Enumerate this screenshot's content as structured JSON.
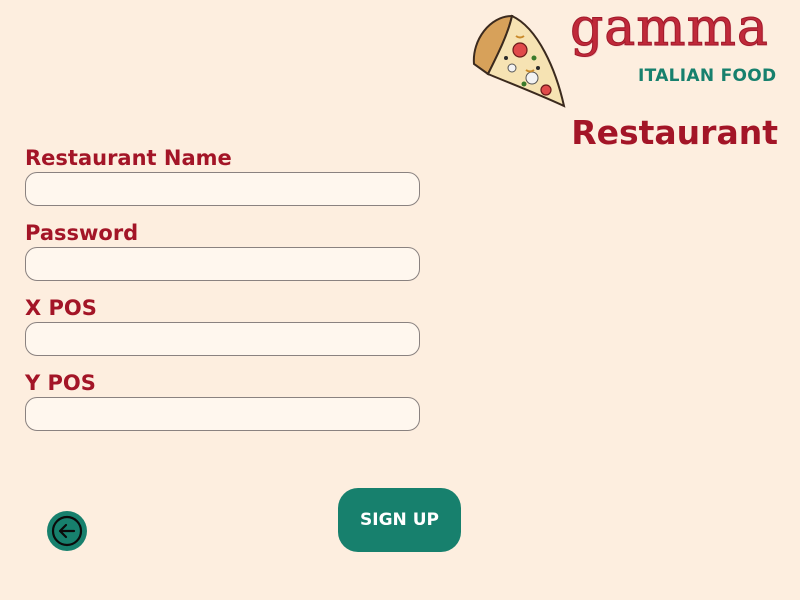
{
  "brand": {
    "name": "gamma",
    "tagline": "ITALIAN FOOD",
    "colors": {
      "accent": "#a31527",
      "primary": "#17806d",
      "background": "#fdeedf",
      "field_bg": "#fff7ee"
    }
  },
  "page": {
    "title": "Restaurant"
  },
  "form": {
    "fields": [
      {
        "label": "Restaurant Name",
        "value": "",
        "placeholder": ""
      },
      {
        "label": "Password",
        "value": "",
        "placeholder": ""
      },
      {
        "label": "X POS",
        "value": "",
        "placeholder": ""
      },
      {
        "label": "Y POS",
        "value": "",
        "placeholder": ""
      }
    ],
    "submit_label": "SIGN UP"
  },
  "nav": {
    "back_icon": "arrow-left-circle-icon"
  }
}
